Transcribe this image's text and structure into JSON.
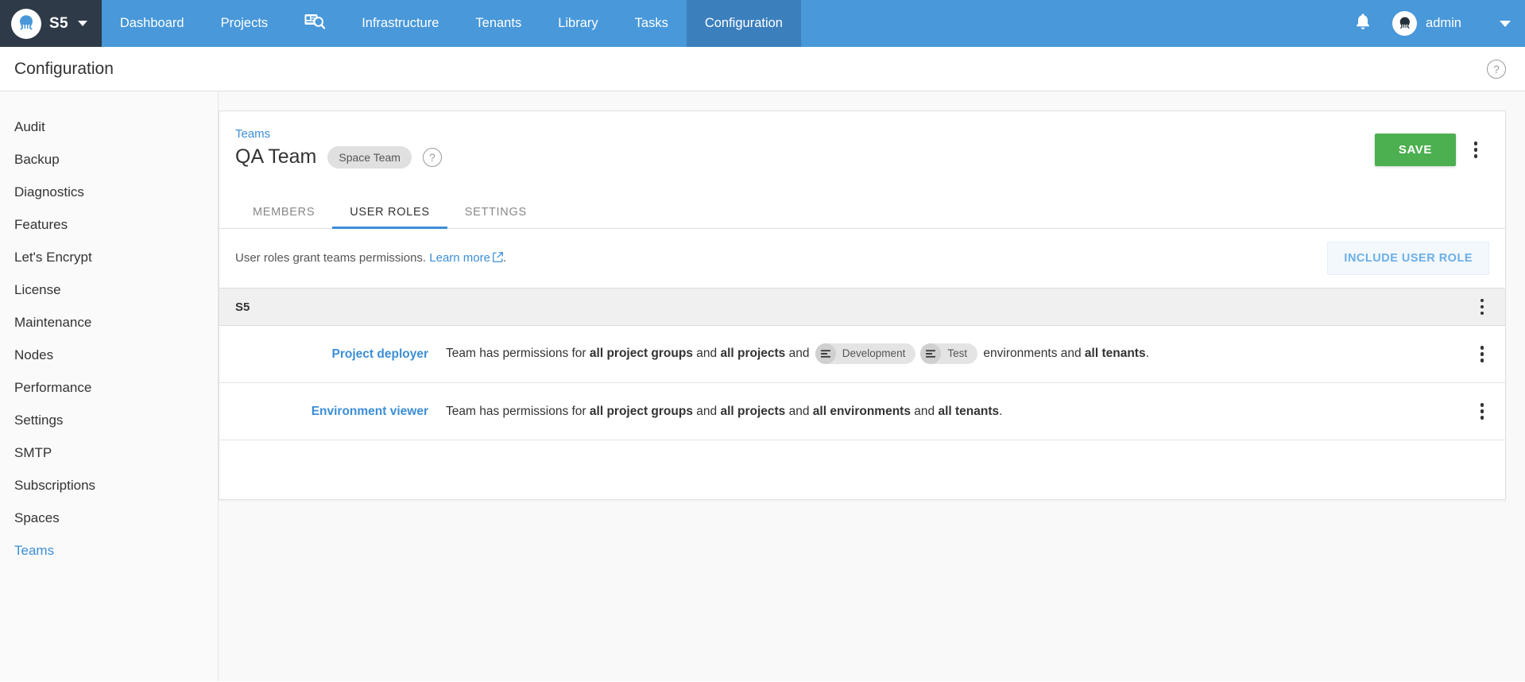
{
  "topnav": {
    "brand": {
      "name": "S5",
      "logo_icon": "octopus-logo-icon",
      "caret_icon": "chevron-down-icon"
    },
    "items": [
      {
        "label": "Dashboard",
        "active": false
      },
      {
        "label": "Projects",
        "active": false
      },
      {
        "label": "",
        "icon": "search-projects-icon",
        "active": false
      },
      {
        "label": "Infrastructure",
        "active": false
      },
      {
        "label": "Tenants",
        "active": false
      },
      {
        "label": "Library",
        "active": false
      },
      {
        "label": "Tasks",
        "active": false
      },
      {
        "label": "Configuration",
        "active": true
      }
    ],
    "notifications_icon": "bell-icon",
    "user": {
      "name": "admin",
      "avatar_icon": "octopus-avatar-icon",
      "caret_icon": "chevron-down-icon"
    }
  },
  "page": {
    "title": "Configuration",
    "help_icon": "help-circle-icon",
    "help_glyph": "?"
  },
  "sidebar": {
    "items": [
      {
        "label": "Audit",
        "active": false
      },
      {
        "label": "Backup",
        "active": false
      },
      {
        "label": "Diagnostics",
        "active": false
      },
      {
        "label": "Features",
        "active": false
      },
      {
        "label": "Let's Encrypt",
        "active": false
      },
      {
        "label": "License",
        "active": false
      },
      {
        "label": "Maintenance",
        "active": false
      },
      {
        "label": "Nodes",
        "active": false
      },
      {
        "label": "Performance",
        "active": false
      },
      {
        "label": "Settings",
        "active": false
      },
      {
        "label": "SMTP",
        "active": false
      },
      {
        "label": "Subscriptions",
        "active": false
      },
      {
        "label": "Spaces",
        "active": false
      },
      {
        "label": "Teams",
        "active": true
      }
    ]
  },
  "team": {
    "breadcrumb": "Teams",
    "name": "QA Team",
    "badge": "Space Team",
    "help_glyph": "?",
    "save_label": "SAVE",
    "overflow_icon": "kebab-menu-icon"
  },
  "tabs": [
    {
      "label": "MEMBERS",
      "active": false
    },
    {
      "label": "USER ROLES",
      "active": true
    },
    {
      "label": "SETTINGS",
      "active": false
    }
  ],
  "info": {
    "text_before": "User roles grant teams permissions.",
    "link_label": "Learn more",
    "external_icon": "external-link-icon",
    "text_after": ".",
    "include_button": "INCLUDE USER ROLE"
  },
  "group": {
    "title": "S5",
    "overflow_icon": "kebab-menu-icon"
  },
  "roles": [
    {
      "name": "Project deployer",
      "parts": [
        {
          "type": "text",
          "value": "Team has permissions for "
        },
        {
          "type": "bold",
          "value": "all project groups"
        },
        {
          "type": "text",
          "value": " and "
        },
        {
          "type": "bold",
          "value": "all projects"
        },
        {
          "type": "text",
          "value": " and "
        },
        {
          "type": "chip",
          "value": "Development"
        },
        {
          "type": "chip",
          "value": "Test"
        },
        {
          "type": "text",
          "value": " environments and "
        },
        {
          "type": "bold",
          "value": "all tenants"
        },
        {
          "type": "text",
          "value": "."
        }
      ]
    },
    {
      "name": "Environment viewer",
      "parts": [
        {
          "type": "text",
          "value": "Team has permissions for "
        },
        {
          "type": "bold",
          "value": "all project groups"
        },
        {
          "type": "text",
          "value": " and "
        },
        {
          "type": "bold",
          "value": "all projects"
        },
        {
          "type": "text",
          "value": " and "
        },
        {
          "type": "bold",
          "value": "all environments"
        },
        {
          "type": "text",
          "value": " and "
        },
        {
          "type": "bold",
          "value": "all tenants"
        },
        {
          "type": "text",
          "value": "."
        }
      ]
    }
  ],
  "colors": {
    "nav_blue": "#4898da",
    "nav_active": "#3b7fbd",
    "brand_dark": "#2e3a47",
    "link_blue": "#3c8ed6",
    "save_green": "#4caf50",
    "chip_gray": "#e0e0e0"
  }
}
